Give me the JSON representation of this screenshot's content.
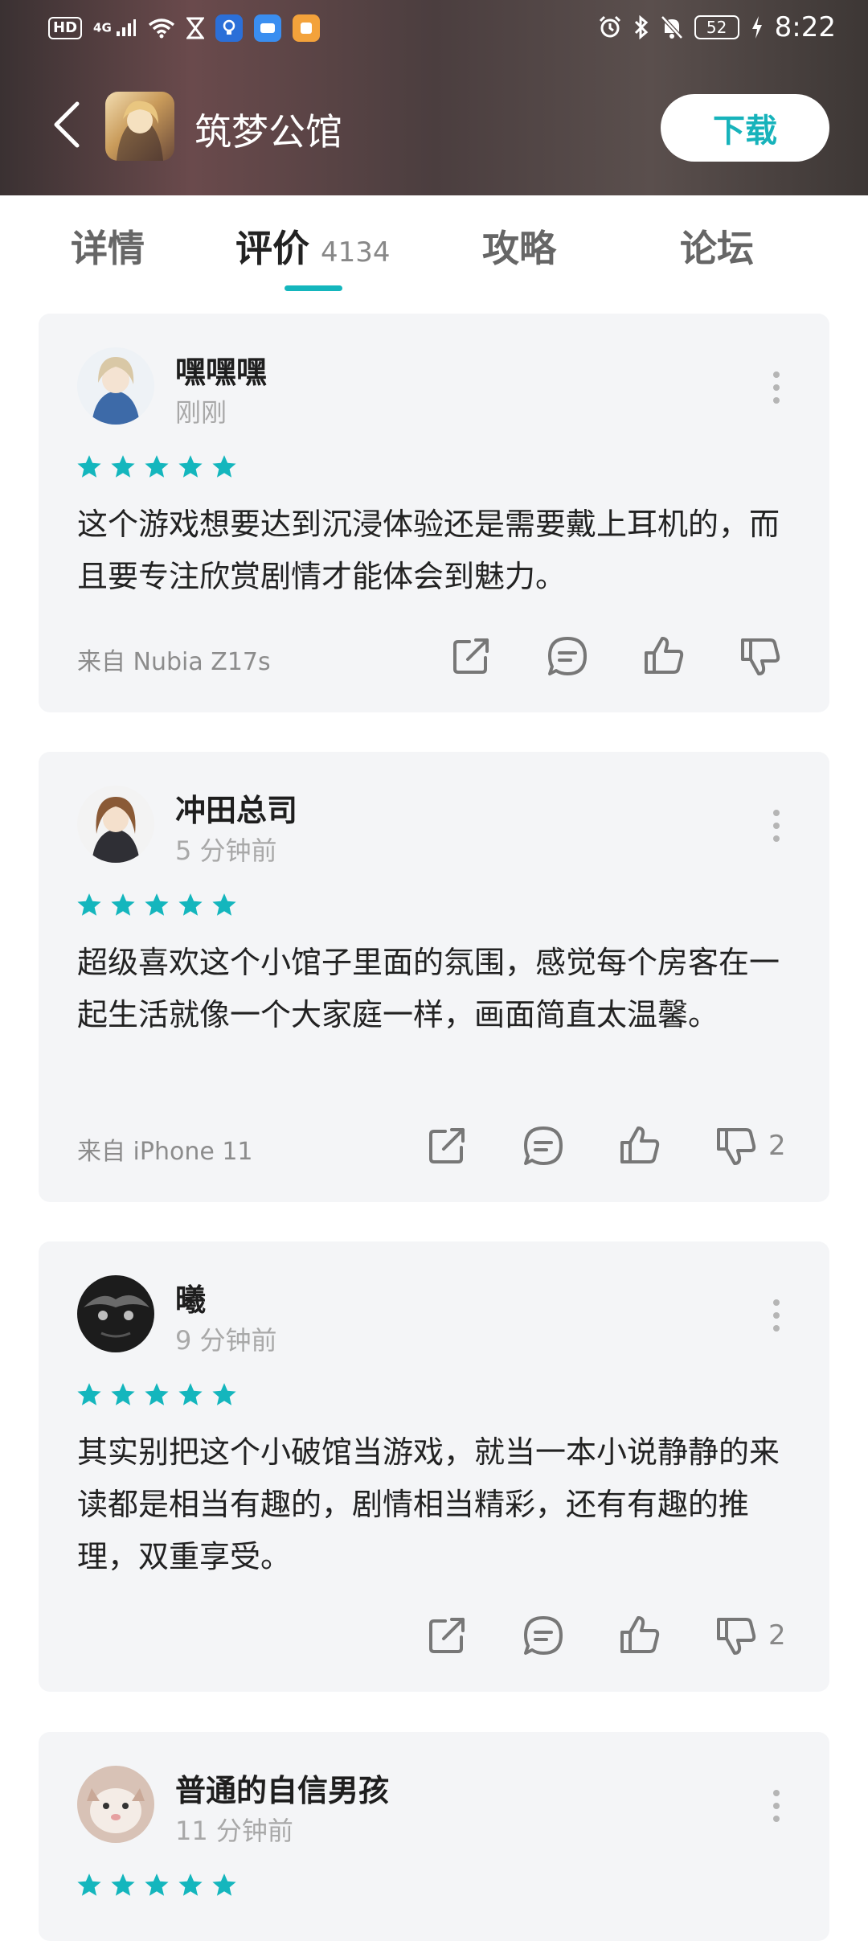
{
  "status_bar": {
    "hd": "HD",
    "network": "4G",
    "battery": "52",
    "time": "8:22",
    "left_icons": [
      "hd-icon",
      "4g-signal-icon",
      "wifi-icon",
      "hourglass-icon",
      "bulb-app-icon",
      "blue-app-icon",
      "orange-app-icon"
    ],
    "right_icons": [
      "alarm-icon",
      "bluetooth-icon",
      "mute-icon",
      "battery-icon",
      "charging-icon"
    ]
  },
  "header": {
    "title": "筑梦公馆",
    "download_label": "下载",
    "accent_color": "#14b6bd"
  },
  "tabs": [
    {
      "label": "详情",
      "active": false
    },
    {
      "label": "评价",
      "count": "4134",
      "active": true
    },
    {
      "label": "攻略",
      "active": false
    },
    {
      "label": "论坛",
      "active": false
    }
  ],
  "reviews": [
    {
      "user": "嘿嘿嘿",
      "time": "刚刚",
      "stars": 5,
      "text": "这个游戏想要达到沉浸体验还是需要戴上耳机的，而且要专注欣赏剧情才能体会到魅力。",
      "device": "来自 Nubia Z17s",
      "dislikes": ""
    },
    {
      "user": "冲田总司",
      "time": "5 分钟前",
      "stars": 5,
      "text": "超级喜欢这个小馆子里面的氛围，感觉每个房客在一起生活就像一个大家庭一样，画面简直太温馨。",
      "device": "来自 iPhone 11",
      "dislikes": "2"
    },
    {
      "user": "曦",
      "time": "9 分钟前",
      "stars": 5,
      "text": "其实别把这个小破馆当游戏，就当一本小说静静的来读都是相当有趣的，剧情相当精彩，还有有趣的推理，双重享受。",
      "device": "",
      "dislikes": "2"
    },
    {
      "user": "普通的自信男孩",
      "time": "11 分钟前",
      "stars": 5
    }
  ]
}
